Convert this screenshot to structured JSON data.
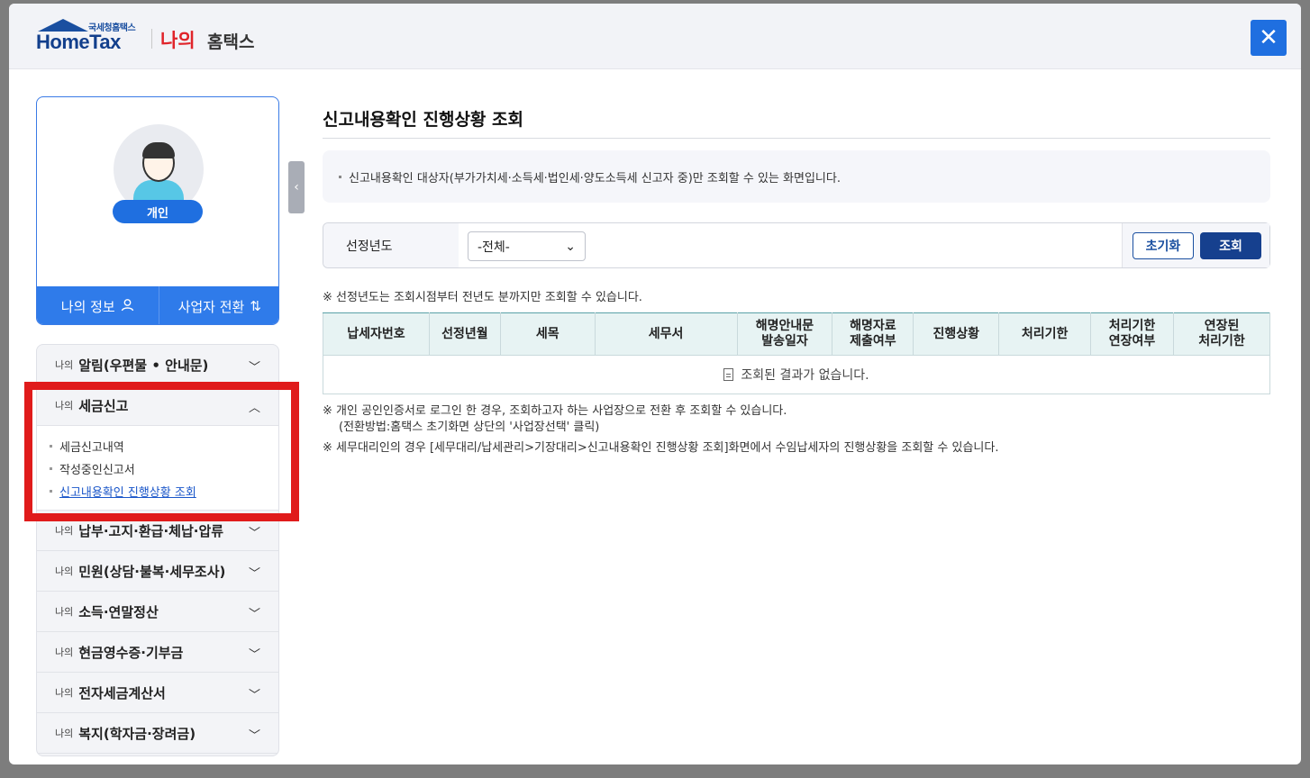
{
  "header": {
    "logo_small": "국세청홈택스",
    "logo_main": "HomeTax",
    "brand_na": "나의",
    "brand_rest": "홈택스",
    "close_icon": "close-icon"
  },
  "profile": {
    "badge": "개인",
    "my_info": "나의 정보",
    "switch_business": "사업자 전환"
  },
  "menu": {
    "prefix": "나의",
    "items": [
      {
        "label": "알림(우편물 • 안내문)"
      },
      {
        "label": "세금신고"
      },
      {
        "label": "납부·고지·환급·체납·압류"
      },
      {
        "label": "민원(상담·불복·세무조사)"
      },
      {
        "label": "소득·연말정산"
      },
      {
        "label": "현금영수증·기부금"
      },
      {
        "label": "전자세금계산서"
      },
      {
        "label": "복지(학자금·장려금)"
      }
    ],
    "sub": [
      "세금신고내역",
      "작성중인신고서",
      "신고내용확인 진행상황 조회"
    ]
  },
  "main": {
    "title": "신고내용확인 진행상황 조회",
    "info": "신고내용확인 대상자(부가가치세·소득세·법인세·양도소득세 신고자 중)만 조회할 수 있는 화면입니다.",
    "search_label": "선정년도",
    "select_value": "-전체-",
    "btn_reset": "초기화",
    "btn_search": "조회",
    "note1": "※ 선정년도는 조회시점부터 전년도 분까지만 조회할 수 있습니다.",
    "columns": [
      "납세자번호",
      "선정년월",
      "세목",
      "세무서",
      "해명안내문\n발송일자",
      "해명자료\n제출여부",
      "진행상황",
      "처리기한",
      "처리기한\n연장여부",
      "연장된\n처리기한"
    ],
    "empty": "조회된 결과가 없습니다.",
    "note2_a": "※ 개인 공인인증서로 로그인 한 경우, 조회하고자 하는 사업장으로 전환 후 조회할 수 있습니다.",
    "note2_b": "(전환방법:홈택스 초기화면 상단의 '사업장선택' 클릭)",
    "note3": "※ 세무대리인의 경우 [세무대리/납세관리>기장대리>신고내용확인 진행상황 조회]화면에서 수임납세자의 진행상황을 조회할 수 있습니다."
  }
}
